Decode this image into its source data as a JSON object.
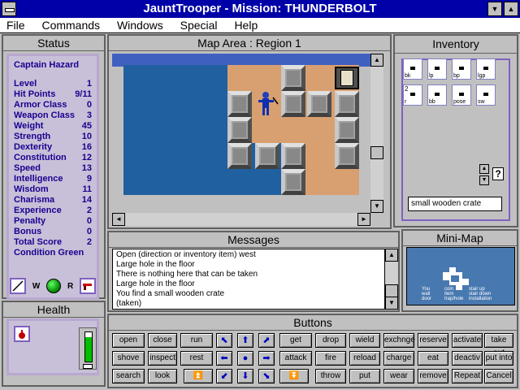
{
  "window": {
    "title": "JauntTrooper - Mission: THUNDERBOLT"
  },
  "menu": {
    "items": [
      "File",
      "Commands",
      "Windows",
      "Special",
      "Help"
    ]
  },
  "status": {
    "title": "Status",
    "character_name": "Captain Hazard",
    "stats": [
      {
        "label": "Level",
        "value": "1"
      },
      {
        "label": "Hit Points",
        "value": "9/11"
      },
      {
        "label": "Armor Class",
        "value": "0"
      },
      {
        "label": "Weapon Class",
        "value": "3"
      },
      {
        "label": "Weight",
        "value": "45"
      },
      {
        "label": "Strength",
        "value": "10"
      },
      {
        "label": "Dexterity",
        "value": "16"
      },
      {
        "label": "Constitution",
        "value": "12"
      },
      {
        "label": "Speed",
        "value": "13"
      },
      {
        "label": "Intelligence",
        "value": "9"
      },
      {
        "label": "Wisdom",
        "value": "11"
      },
      {
        "label": "Charisma",
        "value": "14"
      },
      {
        "label": "Experience",
        "value": "2"
      },
      {
        "label": "Penalty",
        "value": "0"
      },
      {
        "label": "Bonus",
        "value": "0"
      },
      {
        "label": "Total Score",
        "value": "2"
      }
    ],
    "condition": "Condition Green",
    "hand_left_label": "W",
    "hand_right_label": "R"
  },
  "map": {
    "title": "Map Area : Region 1"
  },
  "inventory": {
    "title": "Inventory",
    "slots": [
      {
        "caption": "bk",
        "count": ""
      },
      {
        "caption": "lp",
        "count": ""
      },
      {
        "caption": "bp",
        "count": ""
      },
      {
        "caption": "lgp",
        "count": ""
      },
      {
        "caption": "r",
        "count": "2"
      },
      {
        "caption": "bb",
        "count": ""
      },
      {
        "caption": "pose",
        "count": ""
      },
      {
        "caption": "sw",
        "count": ""
      }
    ],
    "help_button": "?",
    "selected_item": "small wooden crate"
  },
  "messages": {
    "title": "Messages",
    "lines": [
      "Open (direction or inventory item) west",
      "Large hole in the floor",
      "There is nothing here that can be taken",
      "Large hole in the floor",
      "You find a small wooden crate",
      "(taken)"
    ]
  },
  "minimap": {
    "title": "Mini-Map",
    "legend": [
      "You",
      "coin",
      "stair up",
      "wall",
      "item",
      "stair down",
      "door",
      "trap/hole",
      "installation"
    ]
  },
  "health": {
    "title": "Health",
    "hp_fraction": 0.82
  },
  "buttons": {
    "title": "Buttons",
    "rows": [
      [
        "open",
        "close",
        "run",
        "get",
        "drop",
        "wield",
        "exchnge",
        "reserve",
        "activate",
        "take out"
      ],
      [
        "shove",
        "inspect",
        "rest",
        "attack",
        "fire",
        "reload",
        "charge",
        "eat",
        "deactiv",
        "put into"
      ],
      [
        "search",
        "look",
        "",
        "",
        "throw",
        "put",
        "wear",
        "remove",
        "Repeat",
        "Cancel"
      ]
    ]
  },
  "colors": {
    "title_bar": "#0000a8",
    "status_text": "#1a0090",
    "water": "#2060a0",
    "floor": "#d8a070"
  }
}
